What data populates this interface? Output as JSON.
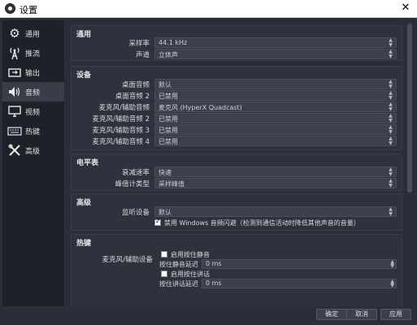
{
  "window": {
    "title": "设置",
    "close_glyph": "✕"
  },
  "sidebar": {
    "items": [
      {
        "label": "通用",
        "icon": "gear-icon",
        "glyph": "⚙"
      },
      {
        "label": "推流",
        "icon": "broadcast-icon",
        "glyph": "📡"
      },
      {
        "label": "输出",
        "icon": "output-icon",
        "glyph": "▭"
      },
      {
        "label": "音频",
        "icon": "speaker-icon",
        "glyph": "🔊"
      },
      {
        "label": "视频",
        "icon": "monitor-icon",
        "glyph": "🖥"
      },
      {
        "label": "热键",
        "icon": "keyboard-icon",
        "glyph": "⌨"
      },
      {
        "label": "高级",
        "icon": "tools-icon",
        "glyph": "✕"
      }
    ],
    "active_index": 3
  },
  "general": {
    "title": "通用",
    "sample_rate_label": "采样率",
    "sample_rate_value": "44.1 kHz",
    "channels_label": "声道",
    "channels_value": "立体声"
  },
  "devices": {
    "title": "设备",
    "rows": [
      {
        "label": "桌面音频",
        "value": "默认"
      },
      {
        "label": "桌面音频 2",
        "value": "已禁用"
      },
      {
        "label": "麦克风/辅助音频",
        "value": "麦克风 (HyperX Quadcast)"
      },
      {
        "label": "麦克风/辅助音频 2",
        "value": "已禁用"
      },
      {
        "label": "麦克风/辅助音频 3",
        "value": "已禁用"
      },
      {
        "label": "麦克风/辅助音频 4",
        "value": "已禁用"
      }
    ]
  },
  "meters": {
    "title": "电平表",
    "decay_label": "衰减速率",
    "decay_value": "快速",
    "peak_label": "峰值计类型",
    "peak_value": "采样峰值"
  },
  "advanced": {
    "title": "高级",
    "monitor_label": "监听设备",
    "monitor_value": "默认",
    "ducking_label": "禁用 Windows 音频闪避（检测到通信活动时降低其他声音的音量）",
    "ducking_checked": true
  },
  "hotkeys": {
    "title": "热键",
    "device_label": "麦克风/辅助设备",
    "push_to_mute_label": "启用按住静音",
    "push_to_mute_delay_label": "按住静音延迟",
    "push_to_mute_delay_value": "0 ms",
    "push_to_talk_label": "启用按住讲话",
    "push_to_talk_delay_label": "按住讲话延迟",
    "push_to_talk_delay_value": "0 ms"
  },
  "footer": {
    "ok_label": "确定",
    "cancel_label": "取消",
    "apply_label": "应用"
  }
}
